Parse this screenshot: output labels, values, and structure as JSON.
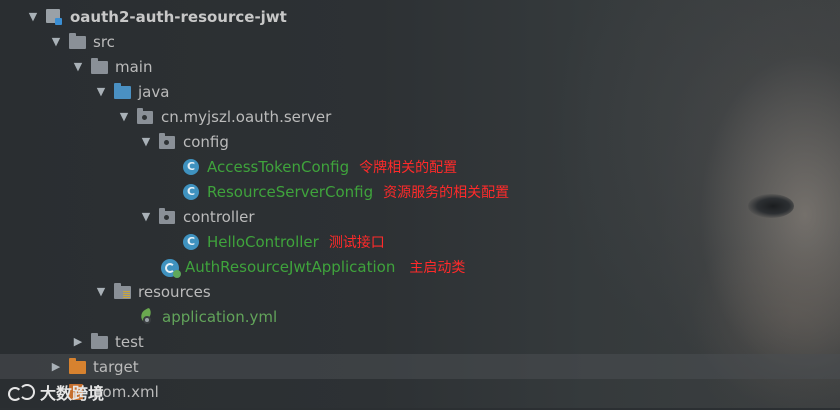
{
  "project_tree": {
    "rows": [
      {
        "label": "oauth2-auth-resource-jwt",
        "note": ""
      },
      {
        "label": "src",
        "note": ""
      },
      {
        "label": "main",
        "note": ""
      },
      {
        "label": "java",
        "note": ""
      },
      {
        "label": "cn.myjszl.oauth.server",
        "note": ""
      },
      {
        "label": "config",
        "note": ""
      },
      {
        "label": "AccessTokenConfig",
        "note": "令牌相关的配置"
      },
      {
        "label": "ResourceServerConfig",
        "note": "资源服务的相关配置"
      },
      {
        "label": "controller",
        "note": ""
      },
      {
        "label": "HelloController",
        "note": "测试接口"
      },
      {
        "label": "AuthResourceJwtApplication",
        "note": "主启动类"
      },
      {
        "label": "resources",
        "note": ""
      },
      {
        "label": "application.yml",
        "note": ""
      },
      {
        "label": "test",
        "note": ""
      },
      {
        "label": "target",
        "note": ""
      },
      {
        "label": "pom.xml",
        "note": ""
      }
    ]
  },
  "watermark": {
    "text": "大数跨境"
  },
  "colors": {
    "annotation": "#ff2a2a",
    "class_name": "#3fa33c",
    "resource_file": "#62a45a",
    "default_text": "#bbbbbb"
  },
  "icons": {
    "expanded": "triangle-down",
    "collapsed": "triangle-right",
    "class": "java-class-c",
    "app": "spring-boot-app",
    "folder": "folder",
    "package": "package",
    "module": "module"
  }
}
